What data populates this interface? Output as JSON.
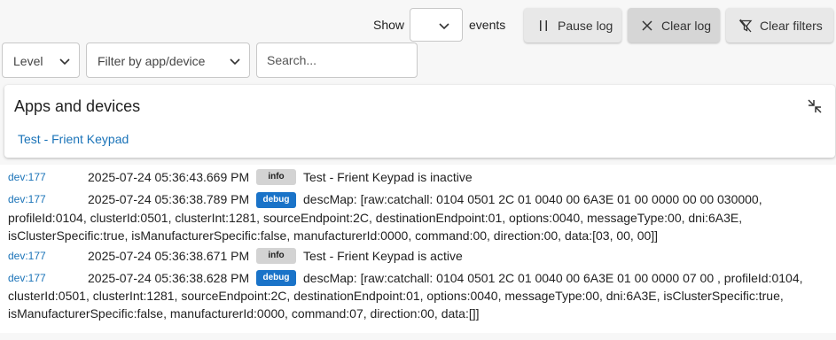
{
  "toolbar": {
    "show_label": "Show",
    "show_count_value": "",
    "events_label": "events",
    "pause_label": "Pause log",
    "clear_label": "Clear log",
    "clear_filters_label": "Clear filters"
  },
  "filters": {
    "level_label": "Level",
    "app_device_label": "Filter by app/device",
    "search_placeholder": "Search..."
  },
  "apps_panel": {
    "title": "Apps and devices",
    "device_link": "Test - Frient Keypad"
  },
  "log": {
    "entries": [
      {
        "source": "dev:177",
        "timestamp": "2025-07-24 05:36:43.669 PM",
        "level": "info",
        "message": "Test - Frient Keypad is inactive"
      },
      {
        "source": "dev:177",
        "timestamp": "2025-07-24 05:36:38.789 PM",
        "level": "debug",
        "message_line1": "descMap: [raw:catchall: 0104 0501 2C 01 0040 00 6A3E 01 00 0000 00 00 030000,",
        "message_rest": "profileId:0104, clusterId:0501, clusterInt:1281, sourceEndpoint:2C, destinationEndpoint:01, options:0040, messageType:00, dni:6A3E, isClusterSpecific:true, isManufacturerSpecific:false, manufacturerId:0000, command:00, direction:00, data:[03, 00, 00]]"
      },
      {
        "source": "dev:177",
        "timestamp": "2025-07-24 05:36:38.671 PM",
        "level": "info",
        "message": "Test - Frient Keypad is active"
      },
      {
        "source": "dev:177",
        "timestamp": "2025-07-24 05:36:38.628 PM",
        "level": "debug",
        "message_line1": "descMap: [raw:catchall: 0104 0501 2C 01 0040 00 6A3E 01 00 0000 07 00 , profileId:0104,",
        "message_rest": "clusterId:0501, clusterInt:1281, sourceEndpoint:2C, destinationEndpoint:01, options:0040, messageType:00, dni:6A3E, isClusterSpecific:true, isManufacturerSpecific:false, manufacturerId:0000, command:07, direction:00, data:[]]"
      }
    ]
  },
  "colors": {
    "link": "#1a73b8",
    "debug_badge": "#1a73c8",
    "info_badge": "#d3d3d3"
  },
  "icons": {
    "pause": "pause-icon",
    "clear": "close-icon",
    "clear_filters": "filter-off-icon",
    "dropdown": "chevron-down-icon",
    "collapse": "collapse-icon"
  }
}
